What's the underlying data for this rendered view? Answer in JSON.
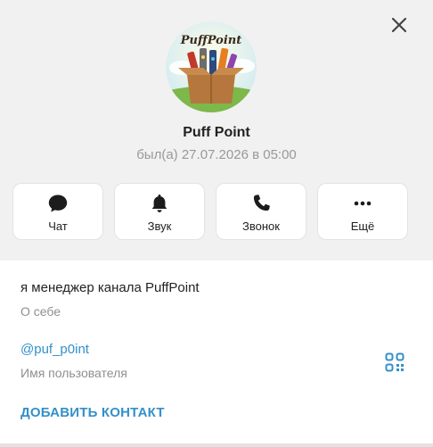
{
  "profile": {
    "avatar_text": "PuffPoint",
    "name": "Puff Point",
    "status": "был(а) 27.07.2026 в 05:00"
  },
  "actions": [
    {
      "label": "Чат",
      "icon": "chat-bubble-icon"
    },
    {
      "label": "Звук",
      "icon": "bell-icon"
    },
    {
      "label": "Звонок",
      "icon": "phone-icon"
    },
    {
      "label": "Ещё",
      "icon": "more-dots-icon"
    }
  ],
  "info": {
    "bio": "я менеджер канала PuffPoint",
    "bio_label": "О себе",
    "username": "@puf_p0int",
    "username_label": "Имя пользователя",
    "add_contact": "ДОБАВИТЬ КОНТАКТ"
  },
  "colors": {
    "accent": "#3390c9",
    "muted": "#8f8f8f"
  }
}
